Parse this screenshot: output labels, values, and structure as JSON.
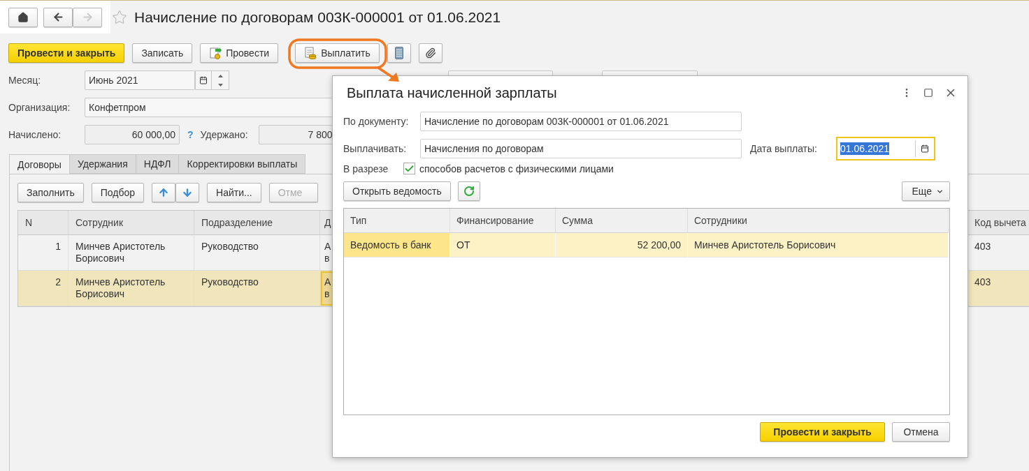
{
  "navigation": {
    "back_disabled": false,
    "forward_disabled": true
  },
  "favorite": {
    "on": false
  },
  "title": "Начисление по договорам 003К-000001 от 01.06.2021",
  "toolbar": [
    {
      "kind": "primary",
      "label": "Провести и закрыть",
      "highlighted": false
    },
    {
      "kind": "plain",
      "label": "Записать",
      "highlighted": false
    },
    {
      "kind": "post",
      "label": "Провести",
      "highlighted": false
    },
    {
      "kind": "pay",
      "label": "Выплатить",
      "highlighted": true
    },
    {
      "kind": "list",
      "highlighted": false
    },
    {
      "kind": "attach",
      "highlighted": false
    }
  ],
  "month": {
    "label": "Месяц:",
    "value": "Июнь 2021"
  },
  "organization": {
    "label": "Организация:",
    "value": "Конфетпром"
  },
  "accrued": {
    "label": "Начислено:",
    "value": "60 000,00",
    "help": "?"
  },
  "withheld": {
    "label": "Удержано:",
    "value": "7 800"
  },
  "tabs": [
    {
      "label": "Договоры",
      "selected": true
    },
    {
      "label": "Удержания",
      "selected": false
    },
    {
      "label": "НДФЛ",
      "selected": false
    },
    {
      "label": "Корректировки выплаты",
      "selected": false
    }
  ],
  "panel_buttons": [
    {
      "kind": "text",
      "label": "Заполнить",
      "disabled": false
    },
    {
      "kind": "text",
      "label": "Подбор",
      "disabled": false
    },
    {
      "kind": "up",
      "disabled": false
    },
    {
      "kind": "down",
      "disabled": false
    },
    {
      "kind": "text",
      "label": "Найти...",
      "disabled": false
    },
    {
      "kind": "text",
      "label": "Отме",
      "disabled": true
    }
  ],
  "table": {
    "columns": [
      "N",
      "Сотрудник",
      "Подразделение",
      "Д",
      "Код вычета"
    ],
    "rows": [
      {
        "selected": false,
        "cells": [
          {
            "text": "1",
            "current": false
          },
          {
            "text": "Минчев Аристотель Борисович",
            "current": false
          },
          {
            "text": "Руководство",
            "current": false
          },
          {
            "text": "А\nв",
            "current": false
          },
          {
            "text": "403",
            "current": false
          }
        ]
      },
      {
        "selected": true,
        "cells": [
          {
            "text": "2",
            "current": false
          },
          {
            "text": "Минчев Аристотель Борисович",
            "current": false
          },
          {
            "text": "Руководство",
            "current": false
          },
          {
            "text": "А\nв",
            "current": true
          },
          {
            "text": "403",
            "current": false
          }
        ]
      }
    ]
  },
  "dialog": {
    "title": "Выплата начисленной зарплаты",
    "document": {
      "label": "По документу:",
      "value": "Начисление по договорам 003К-000001 от 01.06.2021"
    },
    "pay": {
      "label": "Выплачивать:",
      "value": "Начисления по договорам"
    },
    "date": {
      "label": "Дата выплаты:",
      "value": "01.06.2021",
      "text_selected": true,
      "focused": true
    },
    "breakdown": {
      "label": "В разрезе",
      "checked": true,
      "text": "способов расчетов с физическими лицами"
    },
    "open_button": "Открыть ведомость",
    "more_button": "Еще",
    "table": {
      "columns": [
        "Тип",
        "Финансирование",
        "Сумма",
        "Сотрудники"
      ],
      "rows": [
        {
          "selected": true,
          "cells": [
            {
              "text": "Ведомость в банк",
              "current": true
            },
            {
              "text": "ОТ",
              "current": false
            },
            {
              "text": "52 200,00",
              "current": false
            },
            {
              "text": "Минчев Аристотель Борисович",
              "current": false
            }
          ]
        }
      ]
    },
    "buttons": [
      {
        "kind": "primary",
        "label": "Провести и закрыть"
      },
      {
        "kind": "plain",
        "label": "Отмена"
      }
    ]
  }
}
